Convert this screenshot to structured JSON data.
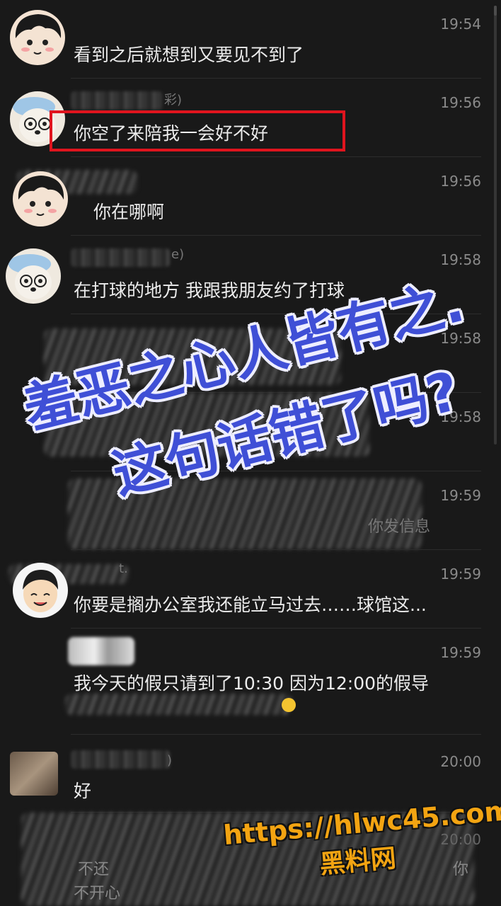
{
  "messages": [
    {
      "time": "19:54",
      "text": "看到之后就想到又要见不到了"
    },
    {
      "time": "19:56",
      "name_suffix": "彩)",
      "text": "你空了来陪我一会好不好"
    },
    {
      "time": "19:56",
      "text": "你在哪啊"
    },
    {
      "time": "19:58",
      "name_suffix": "e)",
      "text": "在打球的地方 我跟我朋友约了打球"
    },
    {
      "time": "19:58",
      "text": ""
    },
    {
      "time": "19:58",
      "text": ""
    },
    {
      "time": "19:59",
      "partial_text": "你发信息"
    },
    {
      "time": "19:59",
      "name_suffix": "t.",
      "text": "你要是搁办公室我还能立马过去……球馆这..."
    },
    {
      "time": "19:59",
      "text": "我今天的假只请到了10:30  因为12:00的假导"
    },
    {
      "time": "20:00",
      "name_suffix": ")",
      "text": "好"
    },
    {
      "time": "20:00",
      "partial_text_1": "不还",
      "partial_text_2": "不开心",
      "partial_text_3": "你"
    }
  ],
  "overlay": {
    "line1": "羞恶之心人皆有之.",
    "line2": "这句话错了吗?",
    "color": "#3f4fd6"
  },
  "watermark": {
    "url": "https://hlwc45.com",
    "name": "黑料网",
    "color": "#f3a412"
  },
  "colors": {
    "background": "#191919",
    "highlight_border": "#e0141e"
  }
}
